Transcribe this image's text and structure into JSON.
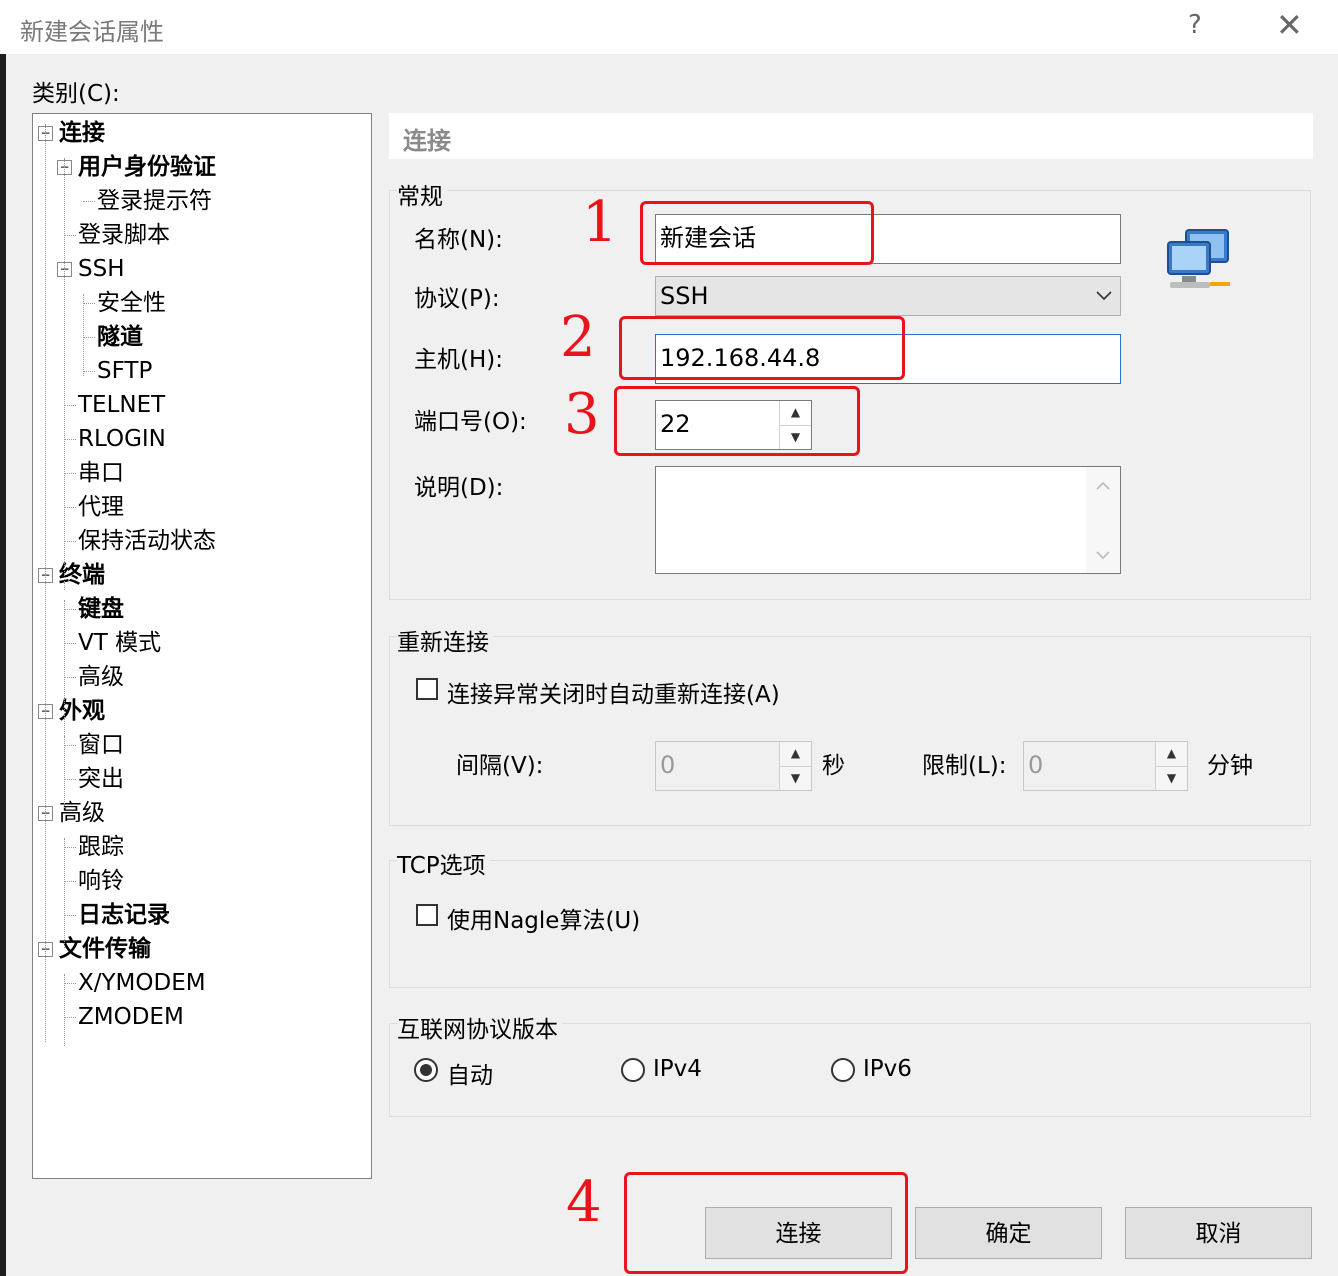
{
  "window": {
    "title": "新建会话属性",
    "help": "?",
    "close": "✕"
  },
  "category_label": "类别(C):",
  "tree": [
    {
      "label": "连接",
      "bold": true,
      "level": 0,
      "expander": "−"
    },
    {
      "label": "用户身份验证",
      "bold": true,
      "level": 1,
      "expander": "−"
    },
    {
      "label": "登录提示符",
      "bold": false,
      "level": 2
    },
    {
      "label": "登录脚本",
      "bold": false,
      "level": 1
    },
    {
      "label": "SSH",
      "bold": false,
      "level": 1,
      "expander": "−"
    },
    {
      "label": "安全性",
      "bold": false,
      "level": 2
    },
    {
      "label": "隧道",
      "bold": true,
      "level": 2
    },
    {
      "label": "SFTP",
      "bold": false,
      "level": 2
    },
    {
      "label": "TELNET",
      "bold": false,
      "level": 1
    },
    {
      "label": "RLOGIN",
      "bold": false,
      "level": 1
    },
    {
      "label": "串口",
      "bold": false,
      "level": 1
    },
    {
      "label": "代理",
      "bold": false,
      "level": 1
    },
    {
      "label": "保持活动状态",
      "bold": false,
      "level": 1
    },
    {
      "label": "终端",
      "bold": true,
      "level": 0,
      "expander": "−"
    },
    {
      "label": "键盘",
      "bold": true,
      "level": 1
    },
    {
      "label": "VT 模式",
      "bold": false,
      "level": 1
    },
    {
      "label": "高级",
      "bold": false,
      "level": 1
    },
    {
      "label": "外观",
      "bold": true,
      "level": 0,
      "expander": "−"
    },
    {
      "label": "窗口",
      "bold": false,
      "level": 1
    },
    {
      "label": "突出",
      "bold": false,
      "level": 1
    },
    {
      "label": "高级",
      "bold": false,
      "level": 0,
      "expander": "−"
    },
    {
      "label": "跟踪",
      "bold": false,
      "level": 1
    },
    {
      "label": "响铃",
      "bold": false,
      "level": 1
    },
    {
      "label": "日志记录",
      "bold": true,
      "level": 1
    },
    {
      "label": "文件传输",
      "bold": true,
      "level": 0,
      "expander": "−"
    },
    {
      "label": "X/YMODEM",
      "bold": false,
      "level": 1
    },
    {
      "label": "ZMODEM",
      "bold": false,
      "level": 1
    }
  ],
  "panel": {
    "header": "连接",
    "general": {
      "title": "常规",
      "name_label": "名称(N):",
      "name_value": "新建会话",
      "protocol_label": "协议(P):",
      "protocol_value": "SSH",
      "host_label": "主机(H):",
      "host_value": "192.168.44.8",
      "port_label": "端口号(O):",
      "port_value": "22",
      "desc_label": "说明(D):",
      "desc_value": ""
    },
    "reconnect": {
      "title": "重新连接",
      "checkbox_label": "连接异常关闭时自动重新连接(A)",
      "interval_label": "间隔(V):",
      "interval_value": "0",
      "interval_unit": "秒",
      "limit_label": "限制(L):",
      "limit_value": "0",
      "limit_unit": "分钟"
    },
    "tcp": {
      "title": "TCP选项",
      "checkbox_label": "使用Nagle算法(U)"
    },
    "ip": {
      "title": "互联网协议版本",
      "options": [
        "自动",
        "IPv4",
        "IPv6"
      ],
      "selected": "自动"
    }
  },
  "buttons": {
    "connect": "连接",
    "ok": "确定",
    "cancel": "取消"
  },
  "annotations": [
    "1",
    "2",
    "3",
    "4"
  ],
  "colors": {
    "annotation": "#e8141b",
    "highlight_border": "#2a6fd1"
  },
  "icons": {
    "session": "network-computers-icon"
  }
}
